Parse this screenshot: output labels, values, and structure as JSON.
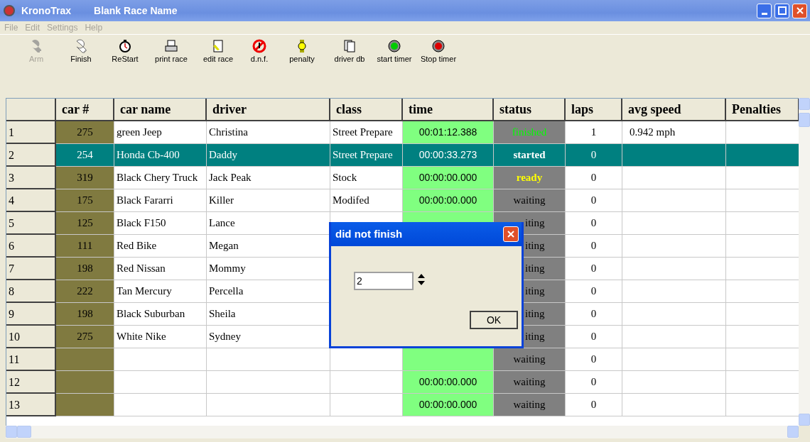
{
  "window": {
    "app": "KronoTrax",
    "title": "Blank Race Name"
  },
  "menu": [
    {
      "label": "File"
    },
    {
      "label": "Edit"
    },
    {
      "label": "Settings"
    },
    {
      "label": "Help"
    }
  ],
  "toolbar": [
    {
      "label": "Arm",
      "disabled": true
    },
    {
      "label": "Finish",
      "disabled": false
    },
    {
      "label": "ReStart",
      "disabled": false
    },
    {
      "label": "print race",
      "disabled": false
    },
    {
      "label": "edit race",
      "disabled": false
    },
    {
      "label": "d.n.f.",
      "disabled": false
    },
    {
      "label": "penalty",
      "disabled": false
    },
    {
      "label": "driver db",
      "disabled": false
    },
    {
      "label": "start timer",
      "disabled": false
    },
    {
      "label": "Stop timer",
      "disabled": false
    }
  ],
  "table": {
    "columns": [
      "car #",
      "car name",
      "driver",
      "class",
      "time",
      "status",
      "laps",
      "avg speed",
      "Penalties"
    ],
    "rows": [
      {
        "num": "1",
        "car": "275",
        "car_name": "green Jeep",
        "driver": "Christina",
        "class": "Street Prepare",
        "time": "00:01:12.388",
        "status": {
          "text": "finished",
          "kind": "finished"
        },
        "laps": "1",
        "avg_speed": "0.942 mph",
        "selected": false
      },
      {
        "num": "2",
        "car": "254",
        "car_name": "Honda Cb-400",
        "driver": "Daddy",
        "class": "Street Prepare",
        "time": "00:00:33.273",
        "status": {
          "text": "started",
          "kind": "started"
        },
        "laps": "0",
        "selected": true
      },
      {
        "num": "3",
        "car": "319",
        "car_name": "Black Chery Truck",
        "driver": "Jack Peak",
        "class": "Stock",
        "time": "00:00:00.000",
        "status": {
          "text": "ready",
          "kind": "ready"
        },
        "laps": "0",
        "selected": false
      },
      {
        "num": "4",
        "car": "175",
        "car_name": "Black Fararri",
        "driver": "Killer",
        "class": "Modifed",
        "time": "00:00:00.000",
        "status": {
          "text": "waiting",
          "kind": "waiting"
        },
        "laps": "0",
        "selected": false
      },
      {
        "num": "5",
        "car": "125",
        "car_name": "Black F150",
        "driver": "Lance",
        "status": {
          "text": "iting",
          "kind": "waiting"
        },
        "laps": "0",
        "selected": false
      },
      {
        "num": "6",
        "car": "111",
        "car_name": "Red Bike",
        "driver": "Megan",
        "status": {
          "text": "iting",
          "kind": "waiting"
        },
        "laps": "0",
        "selected": false
      },
      {
        "num": "7",
        "car": "198",
        "car_name": "Red Nissan",
        "driver": "Mommy",
        "status": {
          "text": "iting",
          "kind": "waiting"
        },
        "laps": "0",
        "selected": false
      },
      {
        "num": "8",
        "car": "222",
        "car_name": "Tan Mercury",
        "driver": "Percella",
        "status": {
          "text": "iting",
          "kind": "waiting"
        },
        "laps": "0",
        "selected": false
      },
      {
        "num": "9",
        "car": "198",
        "car_name": "Black Suburban",
        "driver": "Sheila",
        "status": {
          "text": "iting",
          "kind": "waiting"
        },
        "laps": "0",
        "selected": false
      },
      {
        "num": "10",
        "car": "275",
        "car_name": "White Nike",
        "driver": "Sydney",
        "status": {
          "text": "iting",
          "kind": "waiting"
        },
        "laps": "0",
        "selected": false
      },
      {
        "num": "11",
        "status": {
          "text": "waiting",
          "kind": "waiting"
        },
        "laps": "0",
        "selected": false
      },
      {
        "num": "12",
        "time": "00:00:00.000",
        "status": {
          "text": "waiting",
          "kind": "waiting"
        },
        "laps": "0",
        "selected": false
      },
      {
        "num": "13",
        "time": "00:00:00.000",
        "status": {
          "text": "waiting",
          "kind": "waiting"
        },
        "laps": "0",
        "selected": false
      }
    ]
  },
  "dialog": {
    "title": "did not finish",
    "spin_value": "2",
    "ok": "OK"
  }
}
